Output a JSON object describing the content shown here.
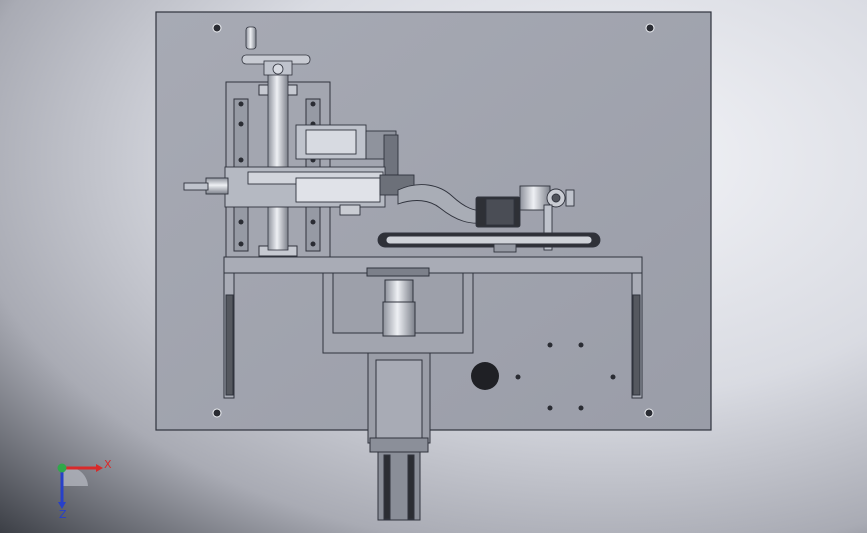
{
  "viewport": {
    "background_outer": "#3c3f46",
    "background_inner": "#eef0f5",
    "plate_color": "#9fa2ad",
    "plate_edge": "#3a3d48",
    "part_color": "#bfc3cc",
    "dark_part_color": "#2c2e35"
  },
  "triad": {
    "x_label": "X",
    "z_label": "Z",
    "x_color": "#d92a2a",
    "y_color": "#2fa84a",
    "z_color": "#2740c9"
  }
}
